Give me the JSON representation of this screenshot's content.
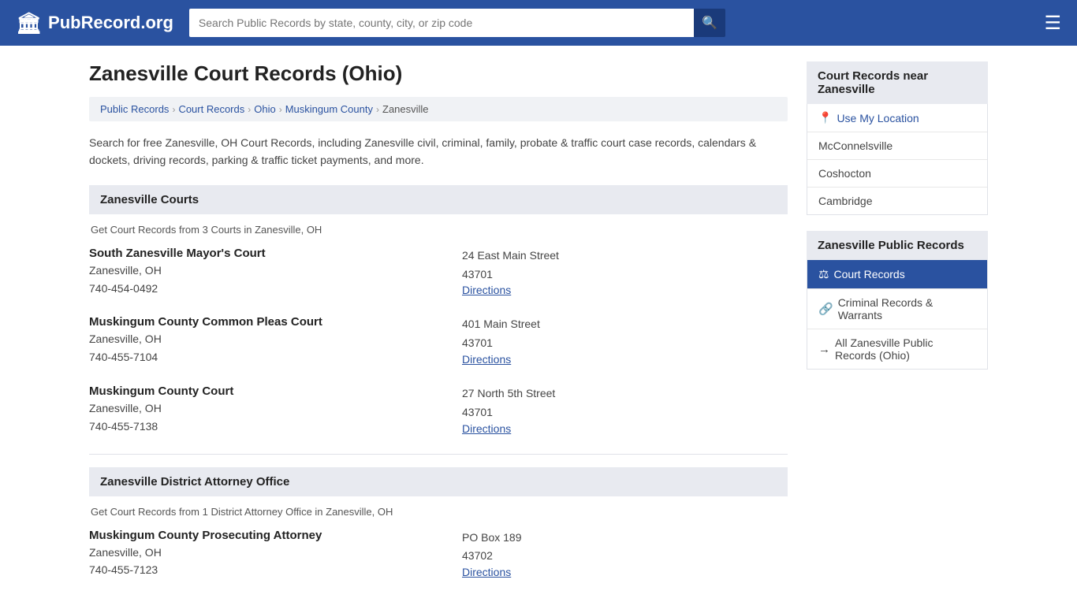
{
  "header": {
    "logo_text": "PubRecord.org",
    "logo_icon": "🏛",
    "search_placeholder": "Search Public Records by state, county, city, or zip code",
    "menu_icon": "☰"
  },
  "page": {
    "title": "Zanesville Court Records (Ohio)",
    "description": "Search for free Zanesville, OH Court Records, including Zanesville civil, criminal, family, probate & traffic court case records, calendars & dockets, driving records, parking & traffic ticket payments, and more."
  },
  "breadcrumb": {
    "items": [
      {
        "label": "Public Records",
        "href": "#"
      },
      {
        "label": "Court Records",
        "href": "#"
      },
      {
        "label": "Ohio",
        "href": "#"
      },
      {
        "label": "Muskingum County",
        "href": "#"
      },
      {
        "label": "Zanesville",
        "current": true
      }
    ]
  },
  "courts_section": {
    "heading": "Zanesville Courts",
    "description": "Get Court Records from 3 Courts in Zanesville, OH",
    "courts": [
      {
        "name": "South Zanesville Mayor's Court",
        "city_state": "Zanesville, OH",
        "phone": "740-454-0492",
        "address": "24 East Main Street",
        "zip": "43701",
        "directions_label": "Directions",
        "directions_href": "#"
      },
      {
        "name": "Muskingum County Common Pleas Court",
        "city_state": "Zanesville, OH",
        "phone": "740-455-7104",
        "address": "401 Main Street",
        "zip": "43701",
        "directions_label": "Directions",
        "directions_href": "#"
      },
      {
        "name": "Muskingum County Court",
        "city_state": "Zanesville, OH",
        "phone": "740-455-7138",
        "address": "27 North 5th Street",
        "zip": "43701",
        "directions_label": "Directions",
        "directions_href": "#"
      }
    ]
  },
  "da_section": {
    "heading": "Zanesville District Attorney Office",
    "description": "Get Court Records from 1 District Attorney Office in Zanesville, OH",
    "offices": [
      {
        "name": "Muskingum County Prosecuting Attorney",
        "city_state": "Zanesville, OH",
        "phone": "740-455-7123",
        "address": "PO Box 189",
        "zip": "43702",
        "directions_label": "Directions",
        "directions_href": "#"
      }
    ]
  },
  "sidebar_nearby": {
    "heading": "Court Records near Zanesville",
    "use_my_location": "Use My Location",
    "locations": [
      {
        "label": "McConnelsville"
      },
      {
        "label": "Coshocton"
      },
      {
        "label": "Cambridge"
      }
    ]
  },
  "sidebar_public_records": {
    "heading": "Zanesville Public Records",
    "items": [
      {
        "label": "Court Records",
        "icon": "⚖",
        "active": true
      },
      {
        "label": "Criminal Records & Warrants",
        "icon": "🔗",
        "active": false
      },
      {
        "label": "All Zanesville Public Records (Ohio)",
        "icon": "→",
        "active": false
      }
    ]
  }
}
